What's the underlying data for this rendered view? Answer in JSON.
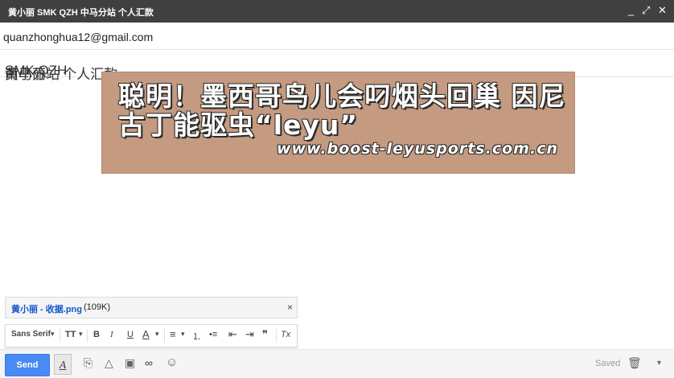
{
  "window": {
    "title": "黄小丽 SMK QZH  中马分站 个人汇款",
    "minimize": "_",
    "popout": "⤢",
    "close": "✕"
  },
  "compose": {
    "to": "quanzhonghua12@gmail.com",
    "subject_part1": "黄小丽",
    "subject_latin": "SMK QZH",
    "subject_part2": "南马分站  个人汇款"
  },
  "overlay": {
    "headline": "聪明！墨西哥鸟儿会叼烟头回巢 因尼古丁能驱虫“leyu”",
    "url": "www.boost-leyusports.com.cn"
  },
  "attachment": {
    "name": "黄小丽 - 收据.png",
    "size": "(109K)",
    "close": "×"
  },
  "format_toolbar": {
    "font": "Sans Serif",
    "font_arrow": "▾",
    "size": "TT",
    "size_arrow": "▾",
    "bold": "B",
    "italic": "I",
    "underline": "U",
    "text_color": "A",
    "color_arrow": "▾",
    "align": "≡",
    "align_arrow": "▾",
    "numbered": "⒈",
    "bulleted": "•≡",
    "indent_less": "⇤",
    "indent_more": "⇥",
    "quote": "❞",
    "remove_format": "Tx"
  },
  "bottom": {
    "send": "Send",
    "formatting": "A",
    "attach": "⎘",
    "drive": "△",
    "photo": "▣",
    "link": "∞",
    "emoji": "☺",
    "saved": "Saved",
    "discard": "🗑",
    "more": "▾"
  }
}
